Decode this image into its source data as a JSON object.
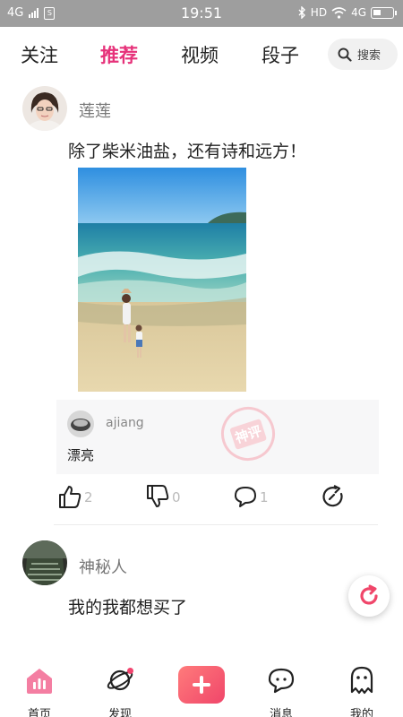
{
  "status_bar": {
    "network_left": "4G",
    "time": "19:51",
    "hd": "HD",
    "network_right": "4G"
  },
  "top_tabs": [
    {
      "label": "关注",
      "active": false
    },
    {
      "label": "推荐",
      "active": true
    },
    {
      "label": "视频",
      "active": false
    },
    {
      "label": "段子",
      "active": false
    }
  ],
  "search": {
    "label": "搜索",
    "icon": "search-icon"
  },
  "posts": [
    {
      "username": "莲莲",
      "text": "除了柴米油盐，还有诗和远方！",
      "comment": {
        "username": "ajiang",
        "text": "漂亮",
        "stamp": "神评"
      },
      "actions": {
        "like_count": "2",
        "dislike_count": "0",
        "comment_count": "1"
      }
    },
    {
      "username": "神秘人",
      "text": "我的我都想买了"
    }
  ],
  "bottom_nav": [
    {
      "label": "首页",
      "icon": "home-icon"
    },
    {
      "label": "发现",
      "icon": "planet-icon"
    },
    {
      "label": "",
      "icon": "plus-icon"
    },
    {
      "label": "消息",
      "icon": "chat-icon"
    },
    {
      "label": "我的",
      "icon": "ghost-icon"
    }
  ],
  "colors": {
    "accent": "#e6327a",
    "fab_gradient_start": "#ff7b7b",
    "fab_gradient_end": "#f0466a"
  }
}
